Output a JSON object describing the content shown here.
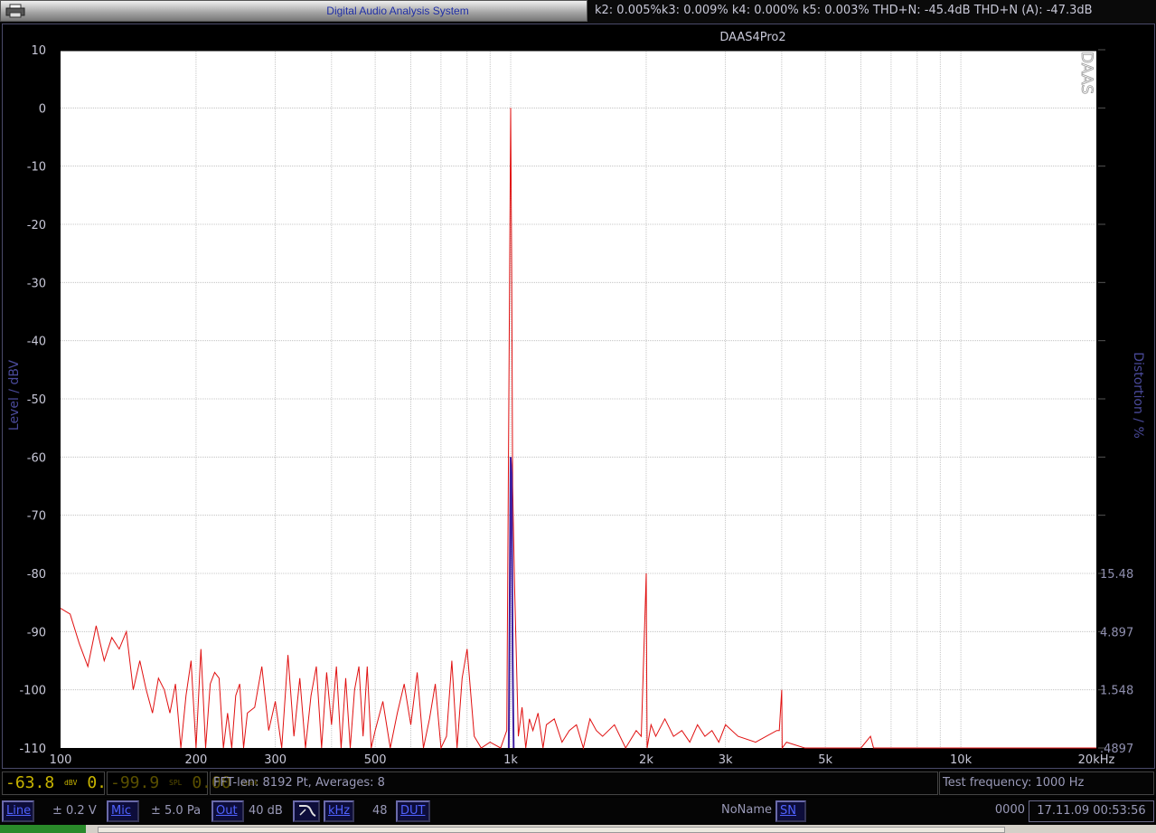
{
  "window": {
    "app_title": "Digital Audio Analysis System",
    "distortion_readout": "k2: 0.005%k3: 0.009% k4: 0.000% k5: 0.003% THD+N: -45.4dB THD+N (A): -47.3dB"
  },
  "chart_data": {
    "type": "line",
    "title": "DAAS4Pro2",
    "watermark": "DAAS",
    "xlabel": "",
    "ylabel": "Level / dBV",
    "y2label": "Distortion / %",
    "x_scale": "log",
    "xlim": [
      100,
      20000
    ],
    "ylim": [
      -110,
      10
    ],
    "grid": true,
    "x_ticks": [
      {
        "v": 100,
        "label": "100"
      },
      {
        "v": 200,
        "label": "200"
      },
      {
        "v": 300,
        "label": "300"
      },
      {
        "v": 500,
        "label": "500"
      },
      {
        "v": 1000,
        "label": "1k"
      },
      {
        "v": 2000,
        "label": "2k"
      },
      {
        "v": 3000,
        "label": "3k"
      },
      {
        "v": 5000,
        "label": "5k"
      },
      {
        "v": 10000,
        "label": "10k"
      },
      {
        "v": 20000,
        "label": "20kHz"
      }
    ],
    "y_ticks": [
      10,
      0,
      -10,
      -20,
      -30,
      -40,
      -50,
      -60,
      -70,
      -80,
      -90,
      -100,
      -110
    ],
    "y2_ticks": [
      {
        "y": -80,
        "label": "15.48"
      },
      {
        "y": -90,
        "label": "4.897"
      },
      {
        "y": -100,
        "label": "1.548"
      },
      {
        "y": -110,
        "label": ".4897"
      }
    ],
    "series": [
      {
        "color": "#e01010",
        "x": [
          100,
          105,
          110,
          115,
          120,
          125,
          130,
          135,
          140,
          145,
          150,
          155,
          160,
          165,
          170,
          175,
          180,
          185,
          190,
          195,
          200,
          205,
          210,
          215,
          220,
          225,
          230,
          235,
          240,
          245,
          250,
          255,
          260,
          270,
          280,
          290,
          300,
          310,
          320,
          330,
          340,
          350,
          360,
          370,
          380,
          390,
          400,
          410,
          420,
          430,
          440,
          450,
          460,
          470,
          480,
          490,
          500,
          520,
          540,
          560,
          580,
          600,
          620,
          640,
          660,
          680,
          700,
          720,
          740,
          760,
          780,
          800,
          830,
          860,
          900,
          950,
          980,
          1000,
          1005,
          1010,
          1020,
          1040,
          1060,
          1080,
          1100,
          1120,
          1150,
          1180,
          1200,
          1250,
          1300,
          1350,
          1400,
          1450,
          1500,
          1550,
          1600,
          1700,
          1800,
          1900,
          1950,
          2000,
          2005,
          2010,
          2050,
          2100,
          2200,
          2300,
          2400,
          2500,
          2600,
          2700,
          2800,
          2900,
          3000,
          3200,
          3500,
          3900,
          3950,
          4000,
          4005,
          4010,
          4100,
          4500,
          5000,
          5500,
          6000,
          6300,
          6400,
          7000,
          8000,
          9000,
          10000,
          12000,
          15000,
          20000
        ],
        "y": [
          -86,
          -87,
          -92,
          -96,
          -89,
          -95,
          -91,
          -93,
          -90,
          -100,
          -95,
          -100,
          -104,
          -98,
          -100,
          -104,
          -99,
          -110,
          -101,
          -95,
          -110,
          -93,
          -110,
          -99,
          -97,
          -98,
          -110,
          -104,
          -110,
          -101,
          -99,
          -110,
          -104,
          -103,
          -96,
          -107,
          -102,
          -110,
          -94,
          -108,
          -98,
          -110,
          -101,
          -96,
          -110,
          -97,
          -106,
          -96,
          -110,
          -98,
          -110,
          -100,
          -96,
          -108,
          -96,
          -110,
          -107,
          -102,
          -110,
          -104,
          -99,
          -106,
          -97,
          -110,
          -105,
          -99,
          -110,
          -108,
          -95,
          -110,
          -98,
          -93,
          -108,
          -110,
          -109,
          -110,
          -107,
          0,
          -27,
          -65,
          -82,
          -108,
          -103,
          -110,
          -105,
          -107,
          -104,
          -110,
          -106,
          -105,
          -109,
          -107,
          -106,
          -110,
          -105,
          -107,
          -108,
          -106,
          -110,
          -107,
          -108,
          -80,
          -97,
          -110,
          -106,
          -108,
          -105,
          -108,
          -107,
          -109,
          -106,
          -108,
          -107,
          -109,
          -106,
          -108,
          -109,
          -107,
          -107,
          -100,
          -106,
          -110,
          -109,
          -110,
          -110,
          -110,
          -110,
          -108,
          -110,
          -110,
          -110,
          -110,
          -110,
          -110,
          -110,
          -110
        ]
      },
      {
        "color": "#4020a0",
        "x": [
          990,
          1000,
          1005,
          1010,
          1015
        ],
        "y": [
          -110,
          -60,
          -63,
          -95,
          -110
        ]
      }
    ]
  },
  "status_row": {
    "lcd_level": "-63.8",
    "lcd_level_unit_top": "dBV",
    "lcd_level_unit_bottom": "V",
    "lcd_level2": "0.00",
    "lcd_level2_unit": "rms",
    "lcd_spl": "-99.9",
    "lcd_spl_unit": "SPL",
    "lcd_spl2": "0.00",
    "lcd_spl2_unit": "peak",
    "fft_info": "FFT-len: 8192 Pt, Averages: 8",
    "test_frequency": "Test frequency: 1000 Hz"
  },
  "control_row": {
    "line_button": "Line",
    "line_range": "± 0.2 V",
    "mic_button": "Mic",
    "mic_range": "± 5.0 Pa",
    "out_button": "Out",
    "out_gain": "40 dB",
    "khz_button": "kHz",
    "sample_rate": "48",
    "dut_button": "DUT",
    "name_value": "NoName",
    "sn_button": "SN",
    "sn_value": "0000",
    "timestamp": "17.11.09 00:53:56"
  }
}
